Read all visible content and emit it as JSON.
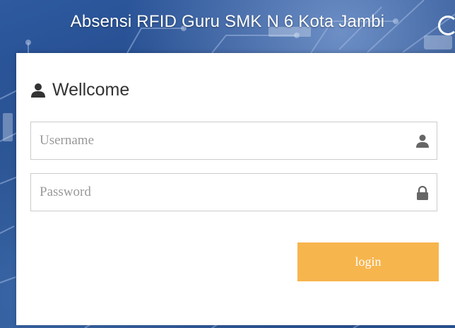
{
  "page": {
    "title": "Absensi RFID Guru SMK N 6 Kota Jambi"
  },
  "login_card": {
    "heading": "Wellcome",
    "heading_icon": "user-icon",
    "username": {
      "placeholder": "Username",
      "value": "",
      "icon": "user-icon"
    },
    "password": {
      "placeholder": "Password",
      "value": "",
      "icon": "lock-icon"
    },
    "login_label": "login"
  },
  "colors": {
    "background": "#23477f",
    "card": "#ffffff",
    "accent_button": "#f7b54d",
    "field_border": "#cccccc",
    "icon": "#666666",
    "heading_text": "#333333",
    "placeholder_text": "#999999"
  }
}
